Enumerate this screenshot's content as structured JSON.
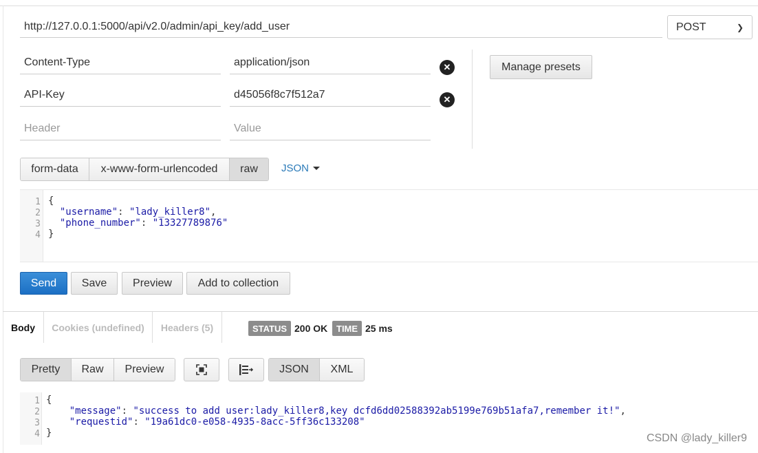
{
  "request": {
    "url": "http://127.0.0.1:5000/api/v2.0/admin/api_key/add_user",
    "method": "POST",
    "headers": [
      {
        "key": "Content-Type",
        "value": "application/json"
      },
      {
        "key": "API-Key",
        "value": "d45056f8c7f512a7"
      }
    ],
    "new_header_key_placeholder": "Header",
    "new_header_value_placeholder": "Value",
    "manage_presets_label": "Manage presets",
    "body_modes": [
      "form-data",
      "x-www-form-urlencoded",
      "raw"
    ],
    "active_body_mode": "raw",
    "raw_type": "JSON",
    "body_lines": [
      "1",
      "2",
      "3",
      "4"
    ],
    "body": {
      "open": "{",
      "username_key": "\"username\"",
      "username_value": "\"lady_killer8\"",
      "phone_key": "\"phone_number\"",
      "phone_value": "\"13327789876\"",
      "close": "}"
    },
    "actions": {
      "send": "Send",
      "save": "Save",
      "preview": "Preview",
      "add_to_collection": "Add to collection"
    }
  },
  "response": {
    "tabs": [
      "Body",
      "Cookies (undefined)",
      "Headers (5)"
    ],
    "active_tab": "Body",
    "status_label": "STATUS",
    "status_value": "200 OK",
    "time_label": "TIME",
    "time_value": "25 ms",
    "view_modes": [
      "Pretty",
      "Raw",
      "Preview"
    ],
    "active_view": "Pretty",
    "formats": [
      "JSON",
      "XML"
    ],
    "active_format": "JSON",
    "icons": [
      "fullscreen-icon",
      "wrap-lines-icon"
    ],
    "body_lines": [
      "1",
      "2",
      "3",
      "4"
    ],
    "body": {
      "open": "{",
      "message_key": "\"message\"",
      "message_value": "\"success to add user:lady_killer8,key dcfd6dd02588392ab5199e769b51afa7,remember it!\"",
      "requestid_key": "\"requestid\"",
      "requestid_value": "\"19a61dc0-e058-4935-8acc-5ff36c133208\"",
      "close": "}"
    }
  },
  "watermark": "CSDN @lady_killer9",
  "colors": {
    "send_button": "#1c6fc4",
    "link": "#2a7ab8",
    "badge": "#8c8c8c",
    "code": "#1a1aa6"
  }
}
